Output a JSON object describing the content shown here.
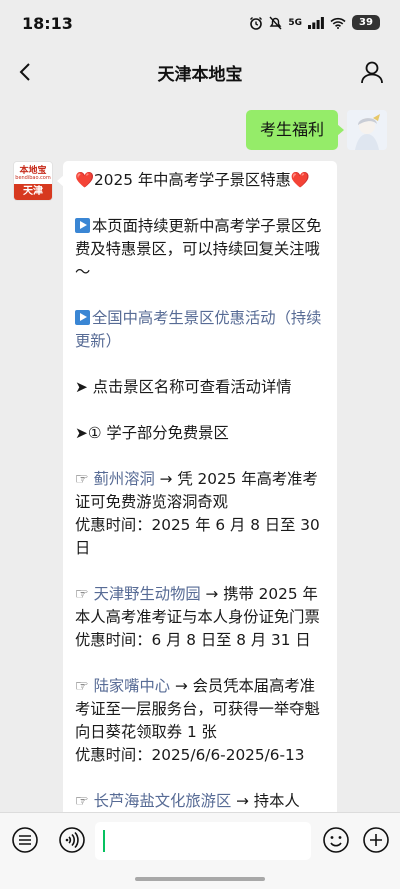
{
  "status_bar": {
    "time": "18:13",
    "network": "5G",
    "battery": "39"
  },
  "nav": {
    "title": "天津本地宝"
  },
  "chat": {
    "sent_message": "考生福利",
    "bot_avatar": {
      "top_text": "本地宝",
      "sub_text": "bendibao.com",
      "city": "天津"
    },
    "reply": {
      "heading": "❤️2025 年中高考学子景区特惠❤️",
      "intro": "本页面持续更新中高考学子景区免费及特惠景区，可以持续回复关注哦～",
      "link_national": "全国中高考生景区优惠活动（持续更新）",
      "tip": "➤ 点击景区名称可查看活动详情",
      "section_title": "➤① 学子部分免费景区",
      "items": [
        {
          "marker": "☞ ",
          "name": "蓟州溶洞",
          "desc": " → 凭 2025 年高考准考证可免费游览溶洞奇观",
          "time": "优惠时间：2025 年 6 月 8 日至 30 日"
        },
        {
          "marker": "☞ ",
          "name": "天津野生动物园",
          "desc": " → 携带 2025 年本人高考准考证与本人身份证免门票",
          "time": "优惠时间：6 月 8 日至 8 月 31 日"
        },
        {
          "marker": "☞ ",
          "name": "陆家嘴中心",
          "desc": " → 会员凭本届高考准考证至一层服务台，可获得一举夺魁向日葵花领取券 1 张",
          "time": "优惠时间：2025/6/6-2025/6-13"
        },
        {
          "marker": "☞ ",
          "name": "长芦海盐文化旅游区",
          "desc": " → 持本人",
          "time": ""
        }
      ]
    }
  },
  "icons": {
    "back": "back-arrow-icon",
    "profile": "person-icon",
    "list": "list-menu-icon",
    "voice": "voice-icon",
    "emoji": "emoji-icon",
    "plus": "plus-icon"
  },
  "colors": {
    "sent_bubble": "#95ec69",
    "link": "#576b95",
    "brand_red": "#d7391f",
    "caret": "#07c160"
  }
}
